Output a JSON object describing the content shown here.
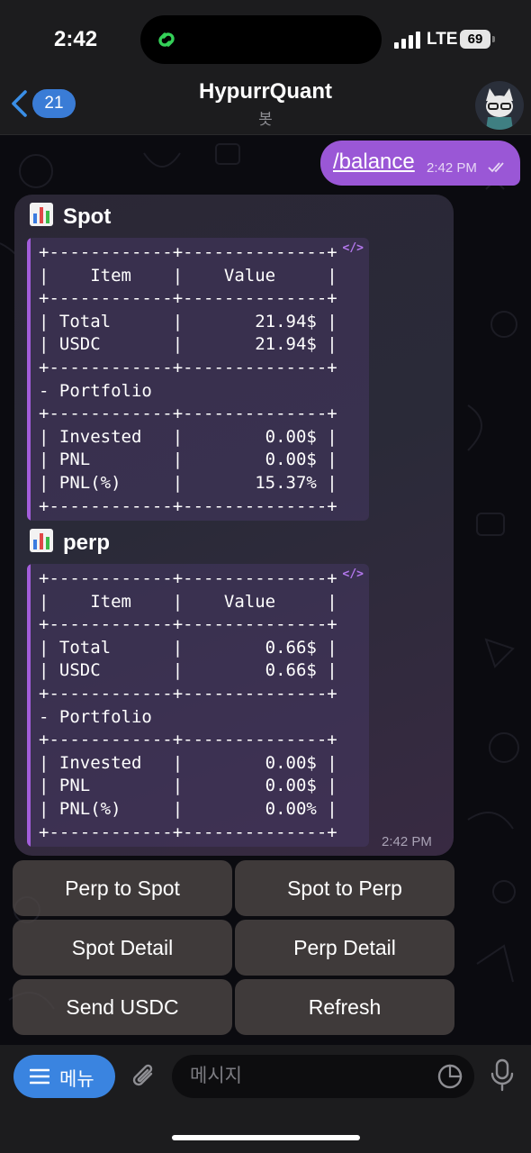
{
  "status_bar": {
    "time": "2:42",
    "network": "LTE",
    "battery": "69"
  },
  "header": {
    "back_count": "21",
    "title": "HypurrQuant",
    "subtitle": "봇"
  },
  "outgoing": {
    "text": "/balance",
    "time": "2:42 PM"
  },
  "incoming": {
    "sections": [
      {
        "title": "Spot",
        "code": "+------------+--------------+\n|    Item    |    Value     |\n+------------+--------------+\n| Total      |       21.94$ |\n| USDC       |       21.94$ |\n+------------+--------------+\n- Portfolio\n+------------+--------------+\n| Invested   |        0.00$ |\n| PNL        |        0.00$ |\n| PNL(%)     |       15.37% |\n+------------+--------------+"
      },
      {
        "title": "perp",
        "code": "+------------+--------------+\n|    Item    |    Value     |\n+------------+--------------+\n| Total      |        0.66$ |\n| USDC       |        0.66$ |\n+------------+--------------+\n- Portfolio\n+------------+--------------+\n| Invested   |        0.00$ |\n| PNL        |        0.00$ |\n| PNL(%)     |        0.00% |\n+------------+--------------+"
      }
    ],
    "code_icon": "</>",
    "time": "2:42 PM"
  },
  "keyboard": {
    "rows": [
      [
        "Perp to Spot",
        "Spot to Perp"
      ],
      [
        "Spot Detail",
        "Perp Detail"
      ],
      [
        "Send USDC",
        "Refresh"
      ]
    ]
  },
  "input_bar": {
    "menu_label": "메뉴",
    "placeholder": "메시지"
  },
  "colors": {
    "outgoing_bubble": "#9a57d6",
    "menu_button": "#3a84e0",
    "code_accent": "#a35edb"
  },
  "icons": [
    "chain-link-icon",
    "back-chevron-icon",
    "chart-emoji-icon",
    "code-icon",
    "double-check-icon",
    "hamburger-icon",
    "paperclip-icon",
    "sticker-icon",
    "microphone-icon"
  ]
}
